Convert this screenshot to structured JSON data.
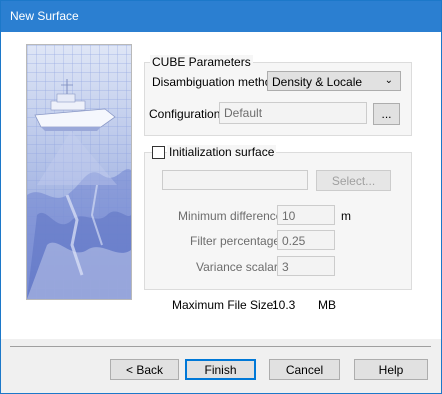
{
  "window": {
    "title": "New Surface"
  },
  "cube": {
    "group_title": "CUBE Parameters",
    "disambiguation_label": "Disambiguation method:",
    "disambiguation_value": "Density & Locale",
    "configuration_label": "Configuration:",
    "configuration_value": "Default",
    "browse_label": "..."
  },
  "init": {
    "checkbox_label": "Initialization surface",
    "checked": false,
    "file_value": "",
    "select_label": "Select...",
    "min_diff_label": "Minimum difference:",
    "min_diff_value": "10",
    "min_diff_unit": "m",
    "filter_label": "Filter percentage:",
    "filter_value": "0.25",
    "variance_label": "Variance scalar:",
    "variance_value": "3"
  },
  "file_size": {
    "label": "Maximum File Size:",
    "value": "10.3",
    "unit": "MB"
  },
  "buttons": {
    "back": "< Back",
    "finish": "Finish",
    "cancel": "Cancel",
    "help": "Help"
  },
  "icons": {
    "combo_arrow": "chevron-down-icon"
  }
}
